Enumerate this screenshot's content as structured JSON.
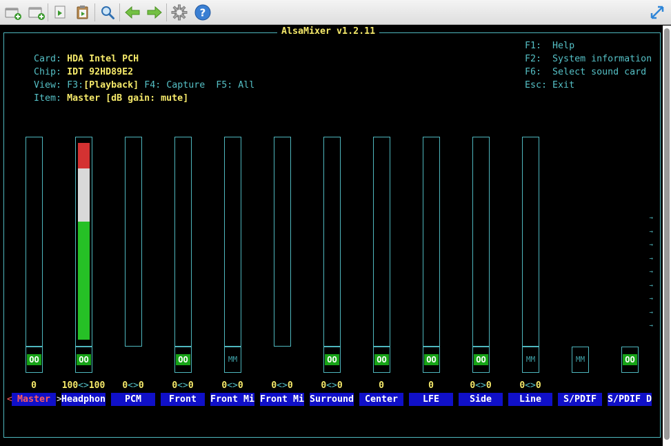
{
  "toolbar": {
    "buttons": [
      {
        "icon": "new-terminal-icon"
      },
      {
        "icon": "new-tab-icon"
      },
      {
        "icon": "copy-icon"
      },
      {
        "icon": "paste-icon"
      },
      {
        "icon": "search-icon"
      },
      {
        "icon": "back-arrow-icon"
      },
      {
        "icon": "forward-arrow-icon"
      },
      {
        "icon": "gear-icon"
      },
      {
        "icon": "help-icon"
      },
      {
        "icon": "fullscreen-icon"
      }
    ]
  },
  "mixer": {
    "title": "AlsaMixer v1.2.11",
    "card_label": "Card:",
    "card_value": "HDA Intel PCH",
    "chip_label": "Chip:",
    "chip_value": "IDT 92HD89E2",
    "view_label": "View:",
    "view_f3_key": "F3:",
    "view_f3": "[Playback]",
    "view_f4": "F4: Capture",
    "view_f5": "F5: All",
    "item_label": "Item:",
    "item_value": "Master [dB gain: mute]",
    "help": [
      {
        "key": "F1:",
        "text": "Help"
      },
      {
        "key": "F2:",
        "text": "System information"
      },
      {
        "key": "F6:",
        "text": "Select sound card"
      },
      {
        "key": "Esc:",
        "text": "Exit"
      }
    ],
    "channels": [
      {
        "name": "Master",
        "volume": "0",
        "switch": "OO",
        "has_gauge": true,
        "level_percent": 0,
        "selected": true
      },
      {
        "name": "Headphon",
        "volume": "100<>100",
        "switch": "OO",
        "has_gauge": true,
        "level_percent": 100,
        "selected": false
      },
      {
        "name": "PCM",
        "volume": "0<>0",
        "switch": "",
        "has_gauge": true,
        "level_percent": 0,
        "selected": false
      },
      {
        "name": "Front",
        "volume": "0<>0",
        "switch": "OO",
        "has_gauge": true,
        "level_percent": 0,
        "selected": false
      },
      {
        "name": "Front Mi",
        "volume": "0<>0",
        "switch": "MM",
        "has_gauge": true,
        "level_percent": 0,
        "selected": false
      },
      {
        "name": "Front Mi",
        "volume": "0<>0",
        "switch": "",
        "has_gauge": true,
        "level_percent": 0,
        "selected": false
      },
      {
        "name": "Surround",
        "volume": "0<>0",
        "switch": "OO",
        "has_gauge": true,
        "level_percent": 0,
        "selected": false
      },
      {
        "name": "Center",
        "volume": "0",
        "switch": "OO",
        "has_gauge": true,
        "level_percent": 0,
        "selected": false
      },
      {
        "name": "LFE",
        "volume": "0",
        "switch": "OO",
        "has_gauge": true,
        "level_percent": 0,
        "selected": false
      },
      {
        "name": "Side",
        "volume": "0<>0",
        "switch": "OO",
        "has_gauge": true,
        "level_percent": 0,
        "selected": false
      },
      {
        "name": "Line",
        "volume": "0<>0",
        "switch": "MM",
        "has_gauge": true,
        "level_percent": 0,
        "selected": false
      },
      {
        "name": "S/PDIF",
        "volume": "",
        "switch": "MM",
        "has_gauge": false,
        "level_percent": 0,
        "selected": false
      },
      {
        "name": "S/PDIF D",
        "volume": "",
        "switch": "OO",
        "has_gauge": false,
        "level_percent": 0,
        "selected": false
      }
    ],
    "select_left": "<",
    "select_right": ">",
    "colors": {
      "frame": "#4fb8bf",
      "label": "#55c0c6",
      "value": "#f5e96a",
      "channel_bg": "#1010c8",
      "selected_name": "#ff5e5e",
      "switch_on": "#17a317",
      "gauge_high": "#d43232",
      "gauge_mid": "#d9d9d9",
      "gauge_low": "#26c026"
    }
  }
}
